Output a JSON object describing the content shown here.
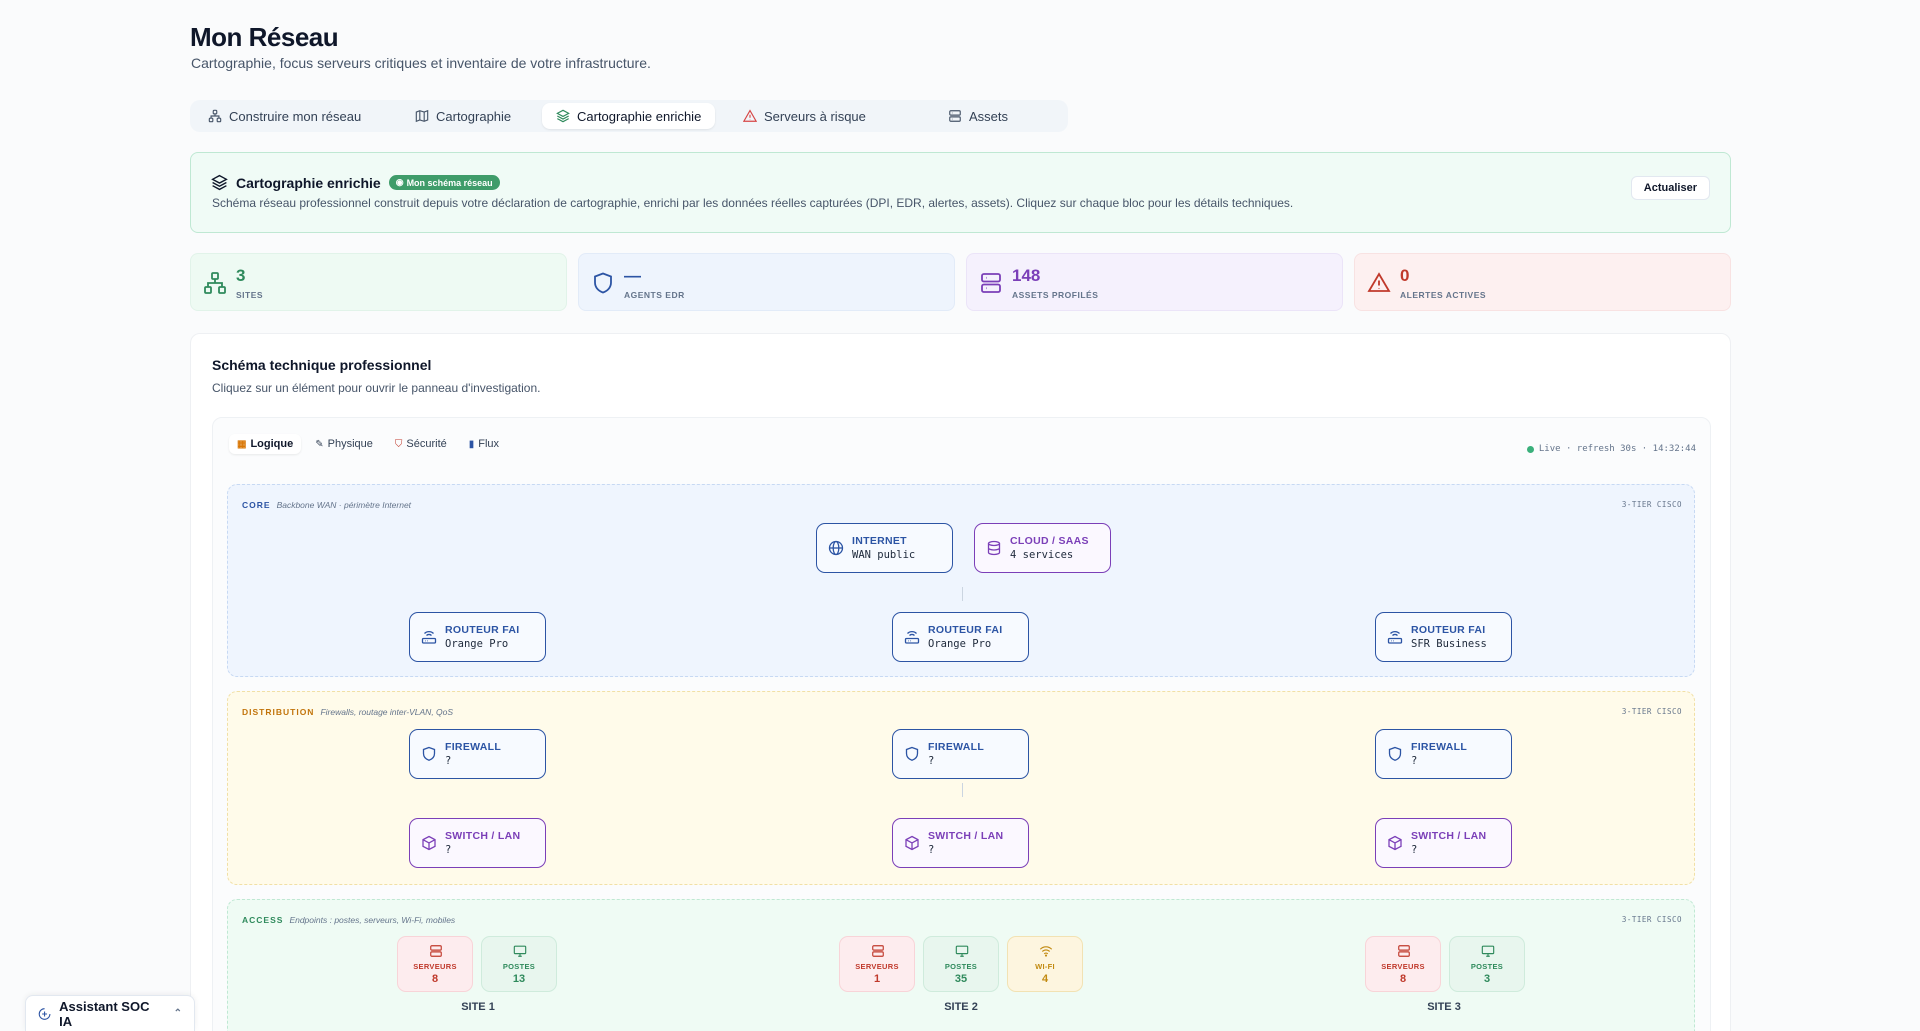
{
  "page": {
    "title": "Mon Réseau",
    "subtitle": "Cartographie, focus serveurs critiques et inventaire de votre infrastructure."
  },
  "tabs": [
    {
      "label": "Construire mon réseau",
      "icon": "network-icon"
    },
    {
      "label": "Cartographie",
      "icon": "map-icon"
    },
    {
      "label": "Cartographie enrichie",
      "icon": "layers-icon",
      "active": true
    },
    {
      "label": "Serveurs à risque",
      "icon": "warning-icon"
    },
    {
      "label": "Assets",
      "icon": "server-icon"
    }
  ],
  "banner": {
    "title": "Cartographie enrichie",
    "badge": "Mon schéma réseau",
    "description": "Schéma réseau professionnel construit depuis votre déclaration de cartographie, enrichi par les données réelles capturées (DPI, EDR, alertes, assets). Cliquez sur chaque bloc pour les détails techniques.",
    "refresh_label": "Actualiser"
  },
  "stats": [
    {
      "value": "3",
      "label": "SITES",
      "color": "#2f8a5c"
    },
    {
      "value": "—",
      "label": "AGENTS EDR",
      "color": "#2c54a4"
    },
    {
      "value": "148",
      "label": "ASSETS PROFILÉS",
      "color": "#7b3fb8"
    },
    {
      "value": "0",
      "label": "ALERTES ACTIVES",
      "color": "#c0392b"
    }
  ],
  "schema": {
    "title": "Schéma technique professionnel",
    "subtitle": "Cliquez sur un élément pour ouvrir le panneau d'investigation.",
    "toolbar": [
      {
        "label": "Logique",
        "glyph": "▦",
        "active": true
      },
      {
        "label": "Physique",
        "glyph": "✎"
      },
      {
        "label": "Sécurité",
        "glyph": "⛉"
      },
      {
        "label": "Flux",
        "glyph": "▮"
      }
    ],
    "live": "Live · refresh 30s · 14:32:44",
    "zones": {
      "core": {
        "name": "CORE",
        "desc": "Backbone WAN · périmètre Internet",
        "tag": "3-TIER CISCO"
      },
      "dist": {
        "name": "DISTRIBUTION",
        "desc": "Firewalls, routage inter-VLAN, QoS",
        "tag": "3-TIER CISCO"
      },
      "acc": {
        "name": "ACCESS",
        "desc": "Endpoints : postes, serveurs, Wi-Fi, mobiles",
        "tag": "3-TIER CISCO"
      }
    },
    "core_nodes": [
      {
        "title": "INTERNET",
        "sub": "WAN public"
      },
      {
        "title": "CLOUD / SAAS",
        "sub": "4 services"
      }
    ],
    "routers": [
      {
        "title": "ROUTEUR FAI",
        "sub": "Orange Pro"
      },
      {
        "title": "ROUTEUR FAI",
        "sub": "Orange Pro"
      },
      {
        "title": "ROUTEUR FAI",
        "sub": "SFR Business"
      }
    ],
    "firewalls": [
      {
        "title": "FIREWALL",
        "sub": "?"
      },
      {
        "title": "FIREWALL",
        "sub": "?"
      },
      {
        "title": "FIREWALL",
        "sub": "?"
      }
    ],
    "switches": [
      {
        "title": "SWITCH / LAN",
        "sub": "?"
      },
      {
        "title": "SWITCH / LAN",
        "sub": "?"
      },
      {
        "title": "SWITCH / LAN",
        "sub": "?"
      }
    ],
    "sites": [
      {
        "label": "SITE 1",
        "chips": [
          {
            "kind": "red",
            "label": "SERVEURS",
            "value": "8"
          },
          {
            "kind": "green",
            "label": "POSTES",
            "value": "13"
          }
        ]
      },
      {
        "label": "SITE 2",
        "chips": [
          {
            "kind": "red",
            "label": "SERVEURS",
            "value": "1"
          },
          {
            "kind": "green",
            "label": "POSTES",
            "value": "35"
          },
          {
            "kind": "amber",
            "label": "WI-FI",
            "value": "4"
          }
        ]
      },
      {
        "label": "SITE 3",
        "chips": [
          {
            "kind": "red",
            "label": "SERVEURS",
            "value": "8"
          },
          {
            "kind": "green",
            "label": "POSTES",
            "value": "3"
          }
        ]
      }
    ]
  },
  "assistant": {
    "label": "Assistant SOC IA"
  }
}
